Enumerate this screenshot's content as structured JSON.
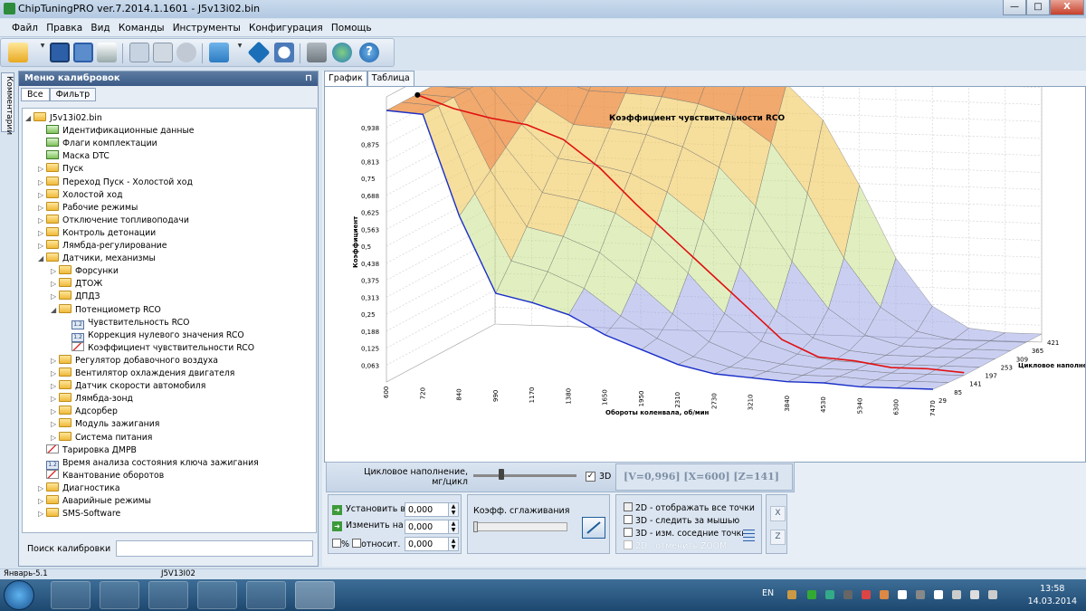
{
  "window": {
    "title": "ChipTuningPRO ver.7.2014.1.1601 - J5v13i02.bin",
    "min_label": "—",
    "max_label": "□",
    "close_label": "X"
  },
  "menu": [
    "Файл",
    "Правка",
    "Вид",
    "Команды",
    "Инструменты",
    "Конфигурация",
    "Помощь"
  ],
  "left_tab": "Комментарии",
  "sidebar": {
    "title": "Меню калибровок",
    "tabs": [
      "Все",
      "Фильтр"
    ],
    "search_label": "Поиск калибровки",
    "search_value": "",
    "tree": [
      {
        "label": "J5v13i02.bin",
        "icon": "folder"
      },
      {
        "label": "Идентификационные данные",
        "icon": "doc-check"
      },
      {
        "label": "Флаги комплектации",
        "icon": "doc-check"
      },
      {
        "label": "Маска DTC",
        "icon": "doc-check"
      },
      {
        "label": "Пуск",
        "icon": "folder"
      },
      {
        "label": "Переход Пуск - Холостой ход",
        "icon": "folder"
      },
      {
        "label": "Холостой ход",
        "icon": "folder"
      },
      {
        "label": "Рабочие режимы",
        "icon": "folder"
      },
      {
        "label": "Отключение топливоподачи",
        "icon": "folder"
      },
      {
        "label": "Контроль детонации",
        "icon": "folder"
      },
      {
        "label": "Лямбда-регулирование",
        "icon": "folder"
      },
      {
        "label": "Датчики, механизмы",
        "icon": "folder"
      },
      {
        "label": "Форсунки",
        "icon": "folder"
      },
      {
        "label": "ДТОЖ",
        "icon": "folder"
      },
      {
        "label": "ДПДЗ",
        "icon": "folder"
      },
      {
        "label": "Потенциометр RCO",
        "icon": "folder"
      },
      {
        "label": "Чувствительность RCO",
        "icon": "table"
      },
      {
        "label": "Коррекция нулевого значения RCO",
        "icon": "table"
      },
      {
        "label": "Коэффициент чувствительности RCO",
        "icon": "graph"
      },
      {
        "label": "Регулятор добавочного воздуха",
        "icon": "folder"
      },
      {
        "label": "Вентилятор охлаждения двигателя",
        "icon": "folder"
      },
      {
        "label": "Датчик скорости автомобиля",
        "icon": "folder"
      },
      {
        "label": "Лямбда-зонд",
        "icon": "folder"
      },
      {
        "label": "Адсорбер",
        "icon": "folder"
      },
      {
        "label": "Модуль зажигания",
        "icon": "folder"
      },
      {
        "label": "Система питания",
        "icon": "folder"
      },
      {
        "label": "Тарировка ДМРВ",
        "icon": "graph"
      },
      {
        "label": "Время анализа состояния ключа зажигания",
        "icon": "table"
      },
      {
        "label": "Квантование оборотов",
        "icon": "graph"
      },
      {
        "label": "Диагностика",
        "icon": "folder"
      },
      {
        "label": "Аварийные режимы",
        "icon": "folder"
      },
      {
        "label": "SMS-Software",
        "icon": "folder"
      }
    ]
  },
  "chart_tabs": [
    "График",
    "Таблица"
  ],
  "chart_data": {
    "type": "surface3d",
    "title": "Коэффициент чувствительности RCO",
    "zlabel": "Коэффициент",
    "xlabel": "Обороты коленвала, об/мин",
    "ylabel": "Цикловое наполне",
    "zticks": [
      "0,063",
      "0,125",
      "0,188",
      "0,25",
      "0,313",
      "0,375",
      "0,438",
      "0,5",
      "0,563",
      "0,625",
      "0,688",
      "0,75",
      "0,813",
      "0,875",
      "0,938"
    ],
    "xticks": [
      "600",
      "720",
      "840",
      "990",
      "1170",
      "1380",
      "1650",
      "1950",
      "2310",
      "2730",
      "3210",
      "3840",
      "4530",
      "5340",
      "6300",
      "7470"
    ],
    "yticks": [
      "29",
      "85",
      "141",
      "197",
      "253",
      "309",
      "365",
      "421"
    ],
    "selected_row_line": {
      "y": 141,
      "z": [
        0.996,
        0.95,
        0.92,
        0.9,
        0.85,
        0.75,
        0.62,
        0.5,
        0.38,
        0.26,
        0.14,
        0.08,
        0.07,
        0.05,
        0.05,
        0.04
      ]
    },
    "front_row_line": {
      "y": 29,
      "z": [
        1.0,
        0.99,
        0.62,
        0.34,
        0.31,
        0.27,
        0.2,
        0.15,
        0.1,
        0.07,
        0.06,
        0.05,
        0.05,
        0.04,
        0.04,
        0.04
      ]
    },
    "grid": true
  },
  "controls": {
    "slider_label": "Цикловое наполнение, мг/цикл",
    "check_3d_label": "3D",
    "coords": "[V=0,996] [X=600] [Z=141]",
    "set_label": "Установить в",
    "change_label": "Изменить на",
    "percent_label": "%",
    "relative_label": "относит.",
    "set_value": "0,000",
    "change_value": "0,000",
    "relative_value": "0,000",
    "smoothing_label": "Коэфф. сглаживания",
    "options": [
      "2D - отображать все точки",
      "3D - следить за мышью",
      "3D - изм. соседние точки",
      "2D - отменить ZOOM"
    ],
    "x_button": "X",
    "z_button": "Z"
  },
  "status": {
    "left": "Январь-5.1",
    "right": "J5V13I02"
  },
  "taskbar": {
    "lang": "EN",
    "time": "13:58",
    "date": "14.03.2014"
  }
}
